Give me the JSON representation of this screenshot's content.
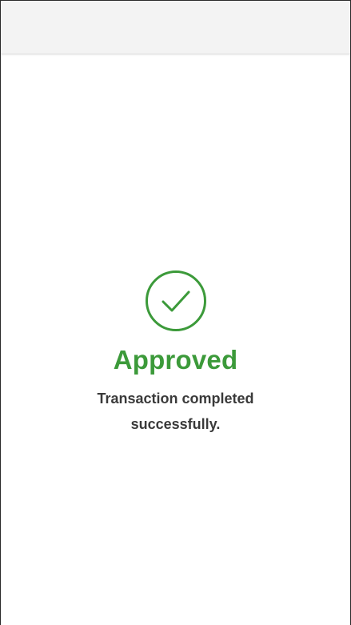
{
  "status": {
    "icon": "check-circle-icon",
    "title": "Approved",
    "message": "Transaction completed successfully."
  },
  "colors": {
    "success": "#3c9a3a",
    "text": "#3a3a3a",
    "header_bg": "#f3f3f3"
  }
}
